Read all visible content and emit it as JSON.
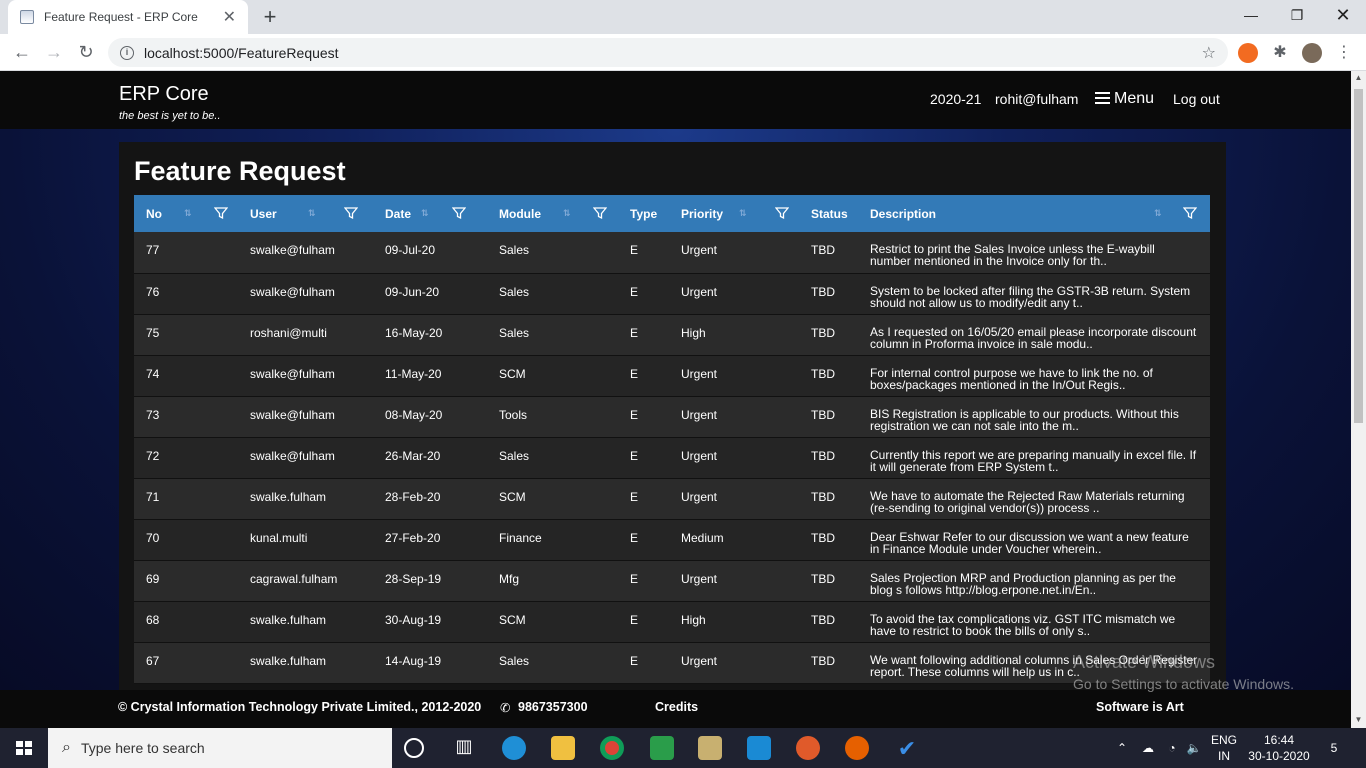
{
  "browser": {
    "tab_title": "Feature Request - ERP Core",
    "url": "localhost:5000/FeatureRequest",
    "colors": {
      "tabstrip": "#dee1e6",
      "toolbar": "#ffffff"
    }
  },
  "header": {
    "brand": "ERP Core",
    "tagline": "the best is yet to be..",
    "year": "2020-21",
    "user": "rohit@fulham",
    "menu_label": "Menu",
    "logout_label": "Log out"
  },
  "page": {
    "title": "Feature Request",
    "columns": [
      "No",
      "User",
      "Date",
      "Module",
      "Type",
      "Priority",
      "Status",
      "Description"
    ],
    "rows": [
      {
        "no": "77",
        "user": "swalke@fulham",
        "date": "09-Jul-20",
        "module": "Sales",
        "type": "E",
        "priority": "Urgent",
        "status": "TBD",
        "description": "Restrict to print the Sales Invoice unless the E-waybill number mentioned in the Invoice only for th.."
      },
      {
        "no": "76",
        "user": "swalke@fulham",
        "date": "09-Jun-20",
        "module": "Sales",
        "type": "E",
        "priority": "Urgent",
        "status": "TBD",
        "description": "System to be locked after filing the GSTR-3B return. System should not allow us to modify/edit any t.."
      },
      {
        "no": "75",
        "user": "roshani@multi",
        "date": "16-May-20",
        "module": "Sales",
        "type": "E",
        "priority": "High",
        "status": "TBD",
        "description": "As I requested on 16/05/20 email please incorporate discount column in Proforma invoice in sale modu.."
      },
      {
        "no": "74",
        "user": "swalke@fulham",
        "date": "11-May-20",
        "module": "SCM",
        "type": "E",
        "priority": "Urgent",
        "status": "TBD",
        "description": "For internal control purpose we have to link the no. of boxes/packages mentioned in the In/Out Regis.."
      },
      {
        "no": "73",
        "user": "swalke@fulham",
        "date": "08-May-20",
        "module": "Tools",
        "type": "E",
        "priority": "Urgent",
        "status": "TBD",
        "description": "BIS Registration is applicable to our products. Without this registration we can not sale into the m.."
      },
      {
        "no": "72",
        "user": "swalke@fulham",
        "date": "26-Mar-20",
        "module": "Sales",
        "type": "E",
        "priority": "Urgent",
        "status": "TBD",
        "description": "Currently this report we are preparing manually in excel file. If it will generate from ERP System t.."
      },
      {
        "no": "71",
        "user": "swalke.fulham",
        "date": "28-Feb-20",
        "module": "SCM",
        "type": "E",
        "priority": "Urgent",
        "status": "TBD",
        "description": "We have to automate the Rejected Raw Materials returning (re-sending to original vendor(s)) process .."
      },
      {
        "no": "70",
        "user": "kunal.multi",
        "date": "27-Feb-20",
        "module": "Finance",
        "type": "E",
        "priority": "Medium",
        "status": "TBD",
        "description": "Dear Eshwar Refer to our discussion we want a new feature in Finance Module under Voucher wherein.."
      },
      {
        "no": "69",
        "user": "cagrawal.fulham",
        "date": "28-Sep-19",
        "module": "Mfg",
        "type": "E",
        "priority": "Urgent",
        "status": "TBD",
        "description": "Sales Projection MRP and Production planning as per the blog s follows http://blog.erpone.net.in/En.."
      },
      {
        "no": "68",
        "user": "swalke.fulham",
        "date": "30-Aug-19",
        "module": "SCM",
        "type": "E",
        "priority": "High",
        "status": "TBD",
        "description": "To avoid the tax complications viz. GST ITC mismatch we have to restrict to book the bills of only s.."
      },
      {
        "no": "67",
        "user": "swalke.fulham",
        "date": "14-Aug-19",
        "module": "Sales",
        "type": "E",
        "priority": "Urgent",
        "status": "TBD",
        "description": "We want following additional columns in Sales Order Register report. These columns will help us in c.."
      }
    ],
    "colors": {
      "header_row": "#337ab7",
      "panel": "#141414",
      "row_odd": "#2b2b2b",
      "row_even": "#252525"
    }
  },
  "footer": {
    "copyright": "© Crystal Information Technology Private Limited., 2012-2020",
    "phone": "9867357300",
    "credits": "Credits",
    "slogan": "Software is Art"
  },
  "watermark": {
    "line1": "Activate Windows",
    "line2": "Go to Settings to activate Windows."
  },
  "taskbar": {
    "search_placeholder": "Type here to search",
    "lang_top": "ENG",
    "lang_bottom": "IN",
    "time": "16:44",
    "date": "30-10-2020",
    "notifications": "5"
  }
}
